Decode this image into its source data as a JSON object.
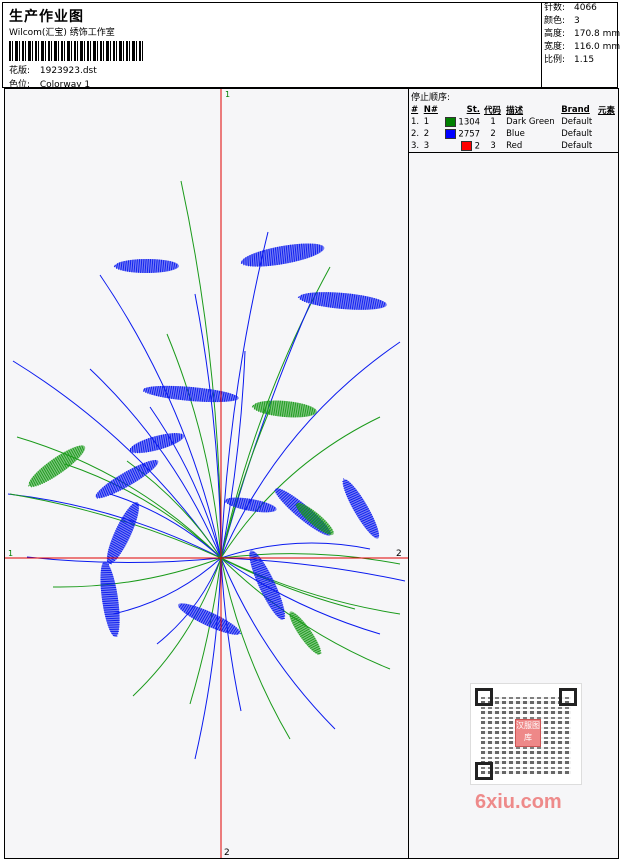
{
  "header": {
    "title": "生产作业图",
    "studio": "Wilcom(汇宝) 绣饰工作室",
    "design_label": "花版:",
    "design_value": "1923923.dst",
    "colorway_label": "色位:",
    "colorway_value": "Colorway 1"
  },
  "stats": [
    {
      "label": "针数:",
      "value": "4066"
    },
    {
      "label": "颜色:",
      "value": "3"
    },
    {
      "label": "高度:",
      "value": "170.8 mm"
    },
    {
      "label": "宽度:",
      "value": "116.0 mm"
    },
    {
      "label": "比例:",
      "value": "1.15"
    }
  ],
  "axes": {
    "top": "1",
    "left": "1",
    "right": "2",
    "bottom": "2"
  },
  "colors_panel": {
    "title": "停止顺序:",
    "headers": [
      "#",
      "N#",
      "St.",
      "代码",
      "描述",
      "Brand",
      "元素"
    ],
    "rows": [
      {
        "idx": "1.",
        "n": "1",
        "stitches": "1304",
        "code": "1",
        "desc": "Dark Green",
        "brand": "Default",
        "color": "#008000"
      },
      {
        "idx": "2.",
        "n": "2",
        "stitches": "2757",
        "code": "2",
        "desc": "Blue",
        "brand": "Default",
        "color": "#0000ff"
      },
      {
        "idx": "3.",
        "n": "3",
        "stitches": "2",
        "code": "3",
        "desc": "Red",
        "brand": "Default",
        "color": "#ff0000"
      }
    ]
  },
  "qr": {
    "stamp": "汉服图库"
  },
  "watermark": "6xiu.com",
  "design_colors": {
    "green": "#1a9a1a",
    "blue": "#0a1aef",
    "red": "#e00000"
  }
}
